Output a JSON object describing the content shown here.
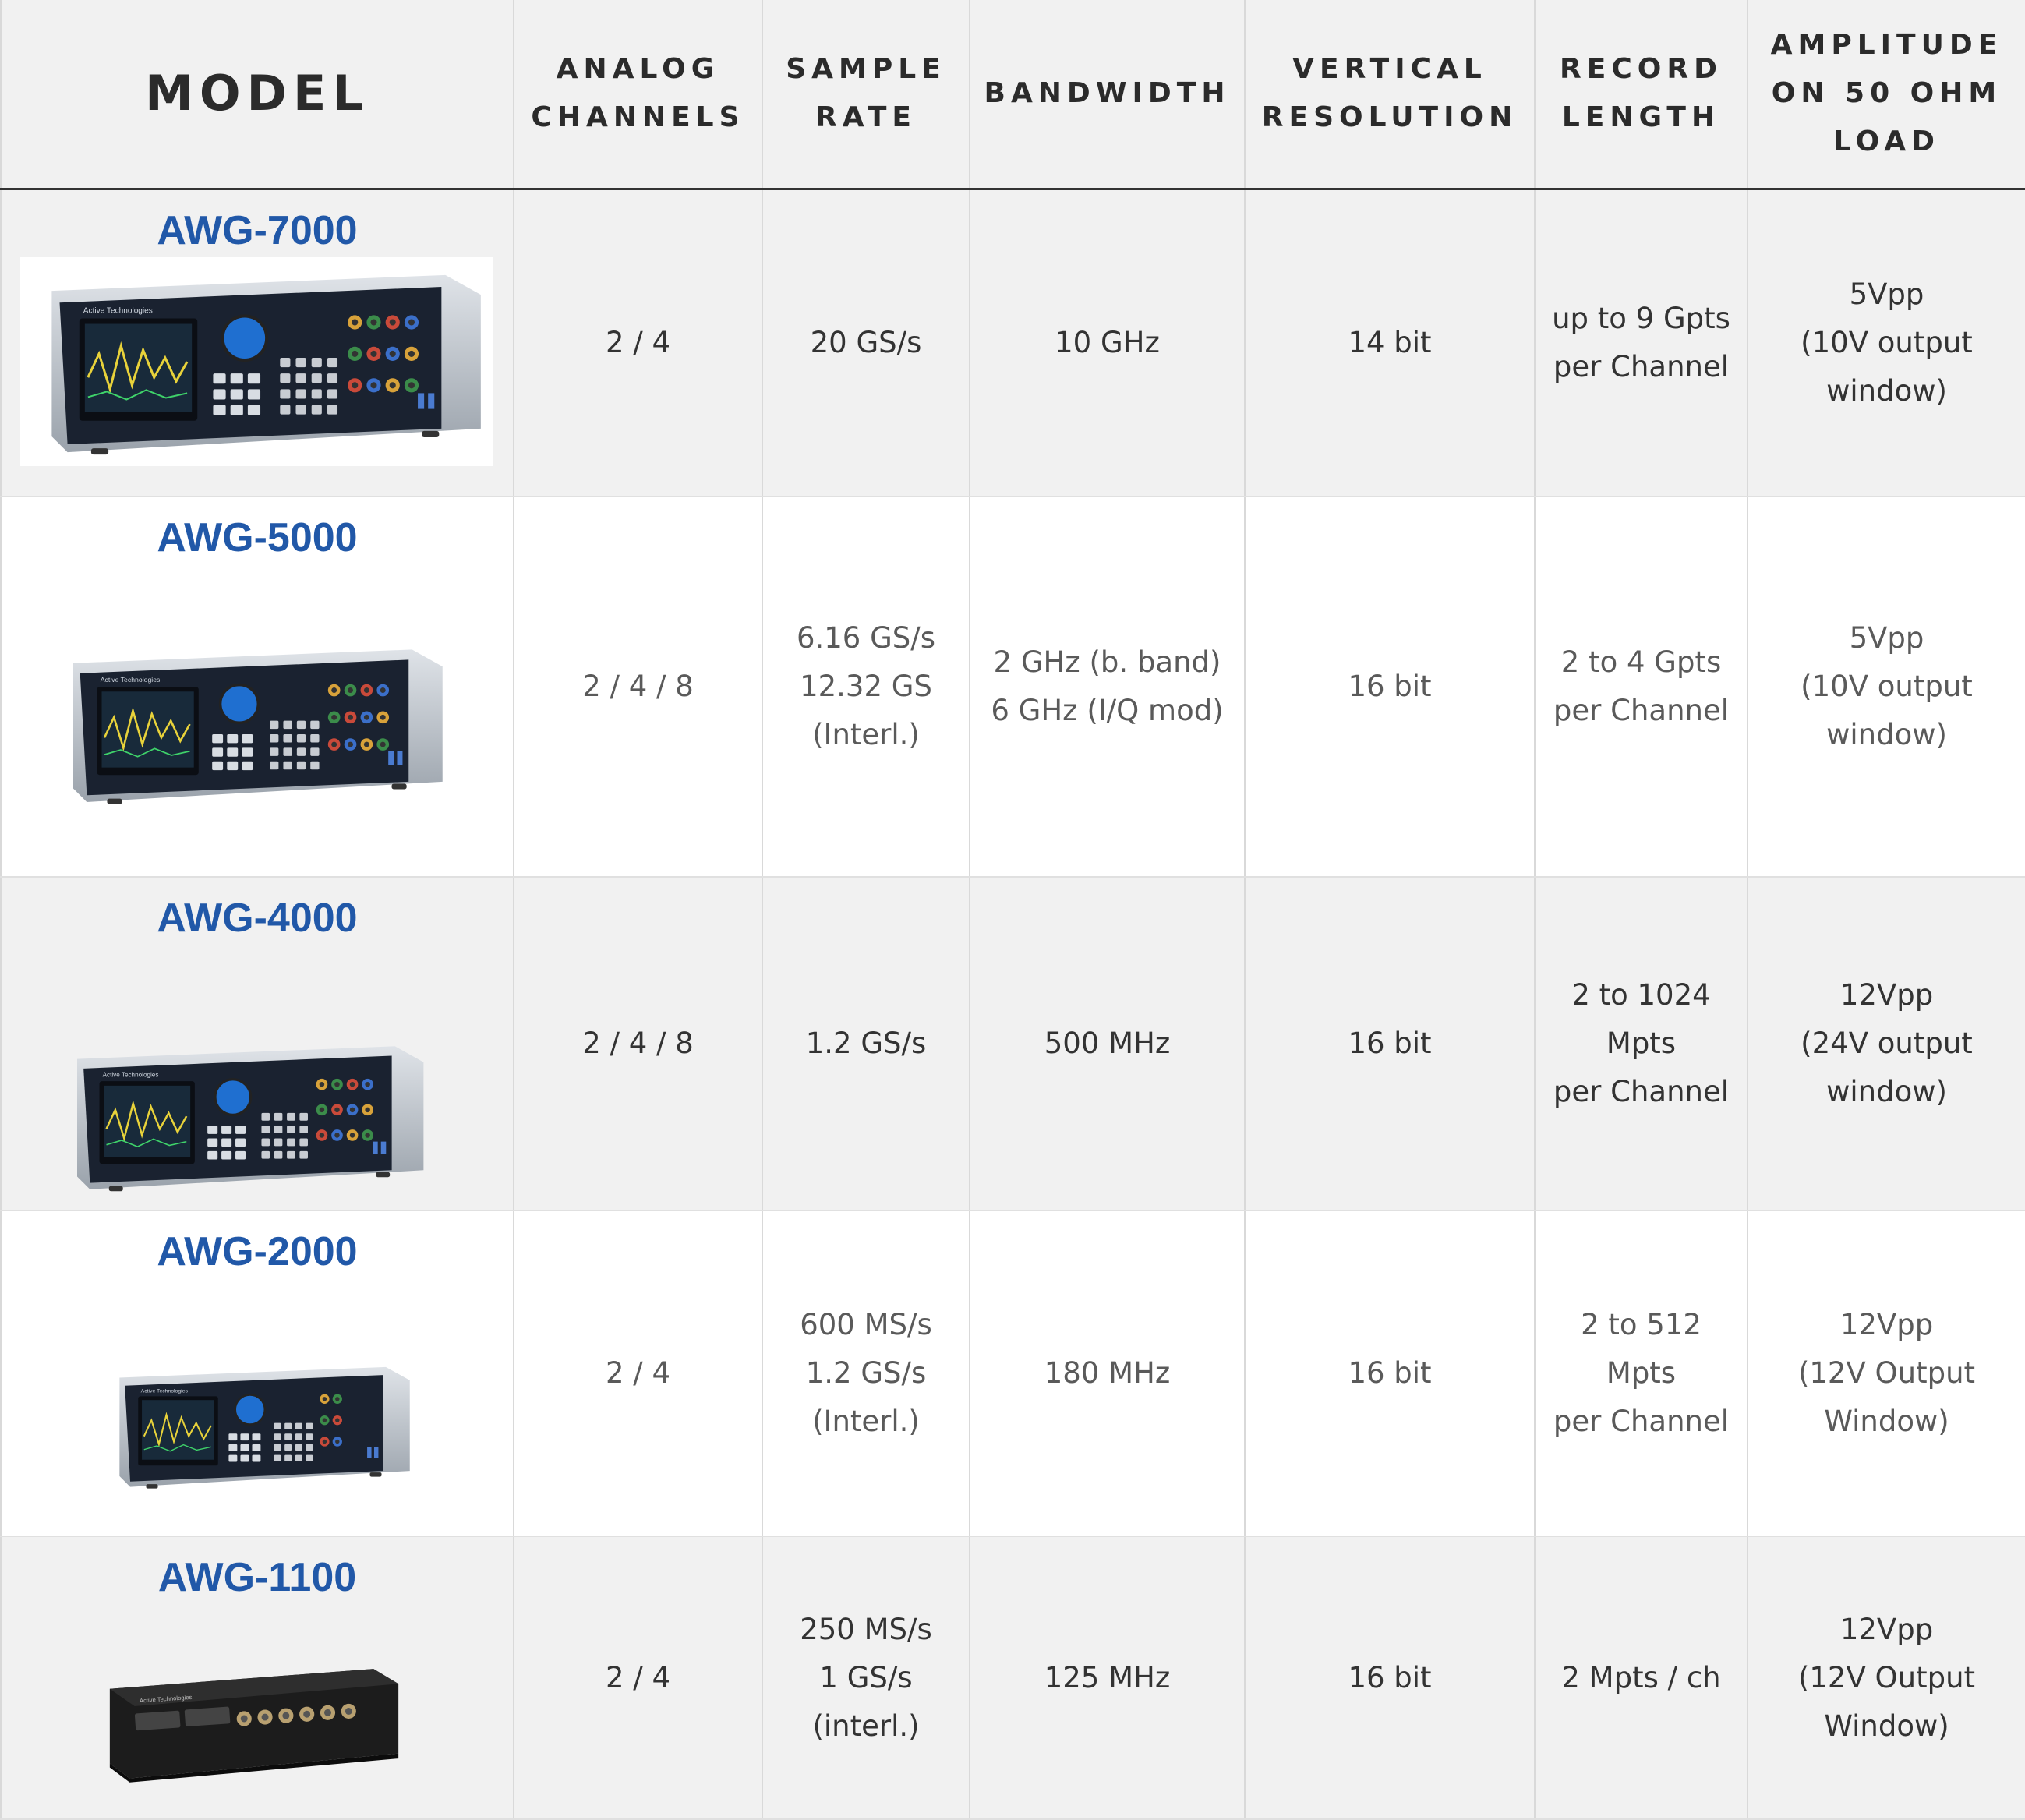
{
  "table": {
    "headers": {
      "model": "MODEL",
      "analog_channels": [
        "ANALOG",
        "CHANNELS"
      ],
      "sample_rate": [
        "SAMPLE",
        "RATE"
      ],
      "bandwidth": [
        "BANDWIDTH"
      ],
      "vertical_resolution": [
        "VERTICAL",
        "RESOLUTION"
      ],
      "record_length": [
        "RECORD",
        "LENGTH"
      ],
      "amplitude": [
        "AMPLITUDE",
        "ON 50 OHM",
        "LOAD"
      ]
    },
    "rows": [
      {
        "model": "AWG-7000",
        "image": "awg-7000-product-photo",
        "analog_channels": [
          "2 / 4"
        ],
        "sample_rate": [
          "20 GS/s"
        ],
        "bandwidth": [
          "10 GHz"
        ],
        "vertical_resolution": [
          "14 bit"
        ],
        "record_length": [
          "up to 9 Gpts",
          "per Channel"
        ],
        "amplitude": [
          "5Vpp",
          "(10V output",
          "window)"
        ]
      },
      {
        "model": "AWG-5000",
        "image": "awg-5000-product-photo",
        "analog_channels": [
          "2 / 4 / 8"
        ],
        "sample_rate": [
          "6.16 GS/s",
          "12.32 GS",
          "(Interl.)"
        ],
        "bandwidth": [
          "2 GHz (b. band)",
          "6 GHz (I/Q mod)"
        ],
        "vertical_resolution": [
          "16 bit"
        ],
        "record_length": [
          "2 to 4 Gpts",
          "per Channel"
        ],
        "amplitude": [
          "5Vpp",
          "(10V output",
          "window)"
        ]
      },
      {
        "model": "AWG-4000",
        "image": "awg-4000-product-photo",
        "analog_channels": [
          "2 / 4 / 8"
        ],
        "sample_rate": [
          "1.2 GS/s"
        ],
        "bandwidth": [
          "500 MHz"
        ],
        "vertical_resolution": [
          "16 bit"
        ],
        "record_length": [
          "2 to 1024",
          "Mpts",
          "per Channel"
        ],
        "amplitude": [
          "12Vpp",
          "(24V output",
          "window)"
        ]
      },
      {
        "model": "AWG-2000",
        "image": "awg-2000-product-photo",
        "analog_channels": [
          "2 / 4"
        ],
        "sample_rate": [
          "600 MS/s",
          "1.2 GS/s",
          "(Interl.)"
        ],
        "bandwidth": [
          "180 MHz"
        ],
        "vertical_resolution": [
          "16 bit"
        ],
        "record_length": [
          "2 to 512",
          "Mpts",
          "per Channel"
        ],
        "amplitude": [
          "12Vpp",
          "(12V Output",
          "Window)"
        ]
      },
      {
        "model": "AWG-1100",
        "image": "awg-1100-product-photo",
        "analog_channels": [
          "2 / 4"
        ],
        "sample_rate": [
          "250 MS/s",
          "1 GS/s",
          "(interl.)"
        ],
        "bandwidth": [
          "125 MHz"
        ],
        "vertical_resolution": [
          "16 bit"
        ],
        "record_length": [
          "2 Mpts / ch"
        ],
        "amplitude": [
          "12Vpp",
          "(12V Output",
          "Window)"
        ]
      }
    ]
  }
}
